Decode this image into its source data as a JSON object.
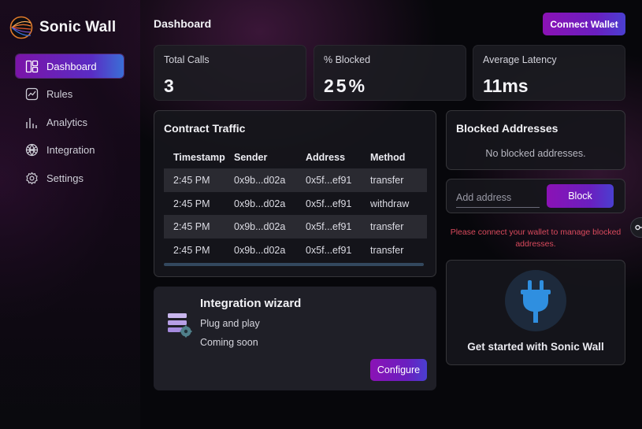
{
  "app": {
    "name": "Sonic Wall"
  },
  "sidebar": {
    "items": [
      {
        "label": "Dashboard",
        "icon": "layout-icon",
        "active": true
      },
      {
        "label": "Rules",
        "icon": "chart-line-icon"
      },
      {
        "label": "Analytics",
        "icon": "bar-chart-icon"
      },
      {
        "label": "Integration",
        "icon": "integration-icon"
      },
      {
        "label": "Settings",
        "icon": "gear-icon"
      }
    ]
  },
  "header": {
    "title": "Dashboard",
    "connect_label": "Connect Wallet"
  },
  "stats": [
    {
      "label": "Total Calls",
      "value": "3"
    },
    {
      "label": "% Blocked",
      "value": "25%"
    },
    {
      "label": "Average Latency",
      "value": "11ms"
    }
  ],
  "traffic": {
    "title": "Contract Traffic",
    "columns": [
      "Timestamp",
      "Sender",
      "Address",
      "Method"
    ],
    "rows": [
      [
        "2:45 PM",
        "0x9b...d02a",
        "0x5f...ef91",
        "transfer"
      ],
      [
        "2:45 PM",
        "0x9b...d02a",
        "0x5f...ef91",
        "withdraw"
      ],
      [
        "2:45 PM",
        "0x9b...d02a",
        "0x5f...ef91",
        "transfer"
      ],
      [
        "2:45 PM",
        "0x9b...d02a",
        "0x5f...ef91",
        "transfer"
      ]
    ]
  },
  "wizard": {
    "title": "Integration wizard",
    "line1": "Plug and play",
    "line2": "Coming soon",
    "button": "Configure"
  },
  "blocked": {
    "title": "Blocked Addresses",
    "empty": "No blocked addresses.",
    "input_placeholder": "Add address",
    "block_label": "Block",
    "warning": "Please connect your wallet to manage blocked addresses."
  },
  "start": {
    "text": "Get started with Sonic Wall"
  },
  "colors": {
    "accent": "#7b14a8",
    "accent_end": "#3a6fd6",
    "warning": "#d94a5c",
    "plug": "#2f8fe0"
  }
}
